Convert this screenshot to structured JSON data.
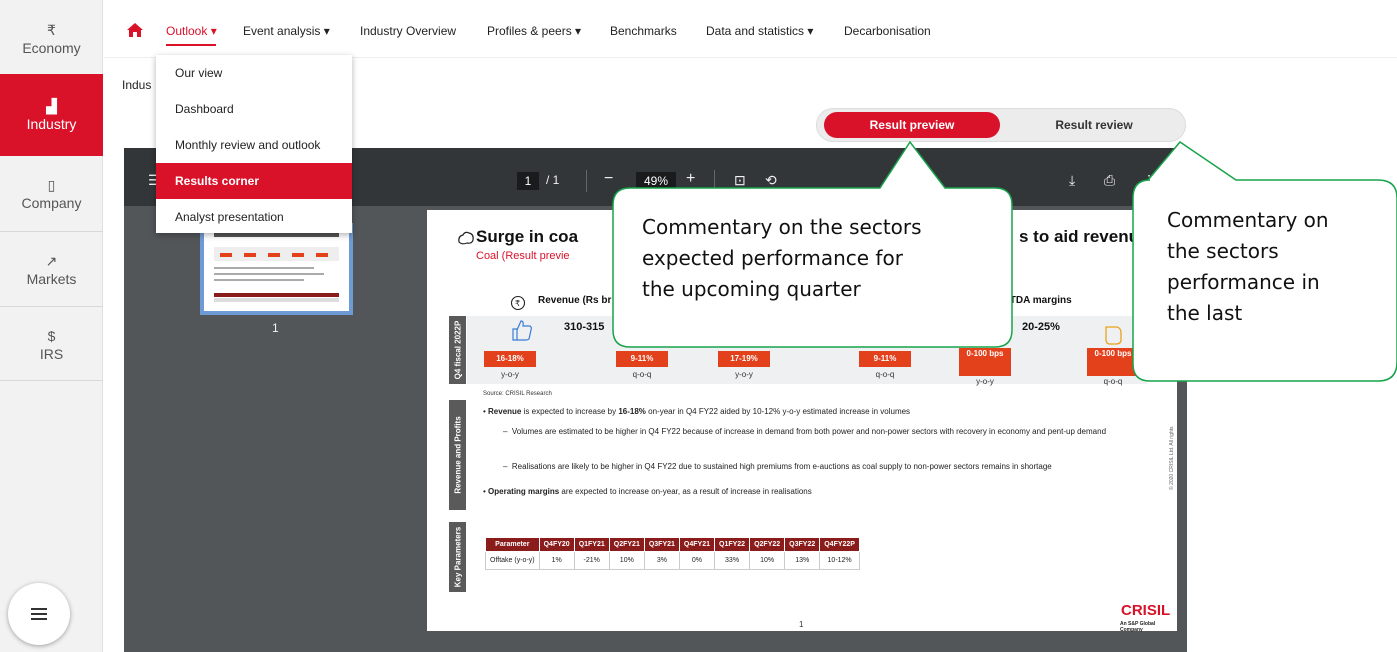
{
  "sidebar": {
    "items": [
      {
        "icon": "₹",
        "label": "Economy"
      },
      {
        "icon": "▟",
        "label": "Industry"
      },
      {
        "icon": "▯",
        "label": "Company"
      },
      {
        "icon": "↗",
        "label": "Markets"
      },
      {
        "icon": "$",
        "label": "IRS"
      }
    ],
    "active": "Industry"
  },
  "topnav": {
    "items": [
      "Outlook ▾",
      "Event analysis ▾",
      "Industry Overview",
      "Profiles & peers ▾",
      "Benchmarks",
      "Data and statistics ▾",
      "Decarbonisation"
    ],
    "active": "Outlook ▾",
    "accent": "#d9122a"
  },
  "breadcrumb": "Indus",
  "dropdown": {
    "items": [
      "Our view",
      "Dashboard",
      "Monthly review and outlook",
      "Results corner",
      "Analyst presentation"
    ],
    "active": "Results corner"
  },
  "toggle": {
    "active_label": "Result preview",
    "other_label": "Result review"
  },
  "viewer": {
    "page_current": "1",
    "page_total": "/ 1",
    "zoom": "49%",
    "thumb_page": "1"
  },
  "doc": {
    "title": "Surge in coa",
    "title_right": "s to aid revenu",
    "subtitle": "Coal (Result previe",
    "revenue_head": "Revenue (Rs br",
    "margin_head": "ITDA margins",
    "quarter_label": "Q4 fiscal 2022P",
    "revenue_value": "310-315",
    "margin_value": "20-25%",
    "metrics": [
      {
        "value": "16-18%",
        "label": "y-o-y"
      },
      {
        "value": "9-11%",
        "label": "q-o-q"
      },
      {
        "value": "17-19%",
        "label": "y-o-y"
      },
      {
        "value": "9-11%",
        "label": "q-o-q"
      },
      {
        "value": "0-100 bps",
        "label": "y-o-y"
      },
      {
        "value": "0-100 bps",
        "label": "q-o-q"
      }
    ],
    "source": "Source: CRISIL Research",
    "section1_label": "Revenue and Profits",
    "bullet1_prefix": "Revenue",
    "bullet1_mid": " is expected to increase by ",
    "bullet1_bold": "16-18%",
    "bullet1_rest": " on-year in Q4 FY22 aided by 10-12% y-o-y estimated increase in volumes",
    "sub1": "Volumes are estimated to be higher in Q4 FY22 because of increase in demand from both power and non-power sectors with recovery in economy and pent-up demand",
    "sub2": "Realisations are likely to be higher in Q4 FY22 due to sustained high premiums from e-auctions as coal supply to non-power sectors remains in shortage",
    "bullet2_bold": "Operating margins",
    "bullet2_rest": " are expected to increase on-year, as a result of increase in realisations",
    "section2_label": "Key Parameters",
    "table": {
      "headers": [
        "Parameter",
        "Q4FY20",
        "Q1FY21",
        "Q2FY21",
        "Q3FY21",
        "Q4FY21",
        "Q1FY22",
        "Q2FY22",
        "Q3FY22",
        "Q4FY22P"
      ],
      "rows": [
        [
          "Offtake (y-o-y)",
          "1%",
          "-21%",
          "10%",
          "3%",
          "0%",
          "33%",
          "10%",
          "13%",
          "10-12%"
        ]
      ]
    },
    "page_number": "1",
    "logo": "CRISIL",
    "logo_sub": "An S&P Global Company",
    "copyright": "© 2020 CRISIL Ltd. All rights"
  },
  "callouts": {
    "left": [
      "Commentary on the sectors",
      "expected performance for",
      "the upcoming quarter"
    ],
    "right": [
      "Commentary on",
      "the sectors",
      "performance in",
      "the last"
    ],
    "border_color": "#17a34a"
  }
}
